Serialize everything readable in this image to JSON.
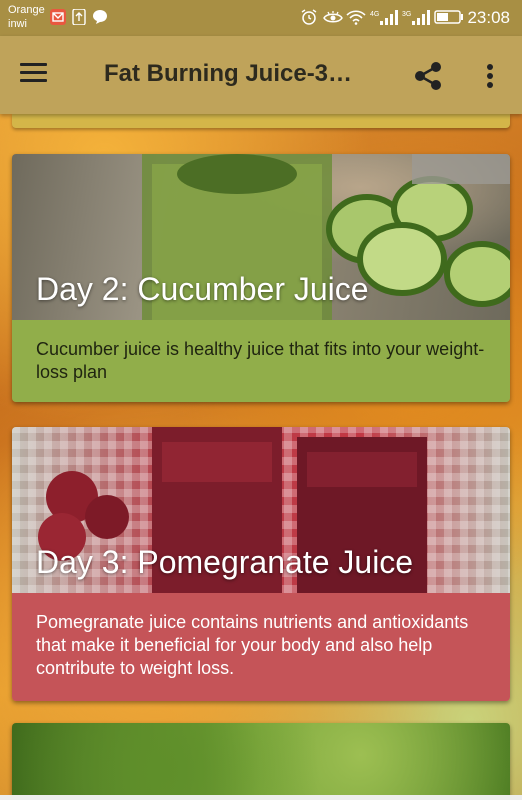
{
  "status_bar": {
    "carrier_line1": "Orange",
    "carrier_line2": "inwi",
    "time": "23:08",
    "network_4g": "4G",
    "network_3g": "3G"
  },
  "app_bar": {
    "title": "Fat Burning Juice-3…",
    "icons": [
      "menu-icon",
      "share-icon",
      "more-vert-icon"
    ]
  },
  "cards": [
    {
      "title": "Day 2: Cucumber Juice",
      "description": "Cucumber juice is healthy juice that fits into your weight-loss plan",
      "color": "#91ae4a"
    },
    {
      "title": "Day 3: Pomegranate Juice",
      "description": "Pomegranate juice contains nutrients and antioxidants that make it beneficial for your body and also help contribute to weight loss.",
      "color": "#c55458"
    }
  ],
  "colors": {
    "status_bar": "#a88f44",
    "app_bar": "#bfa35a"
  }
}
